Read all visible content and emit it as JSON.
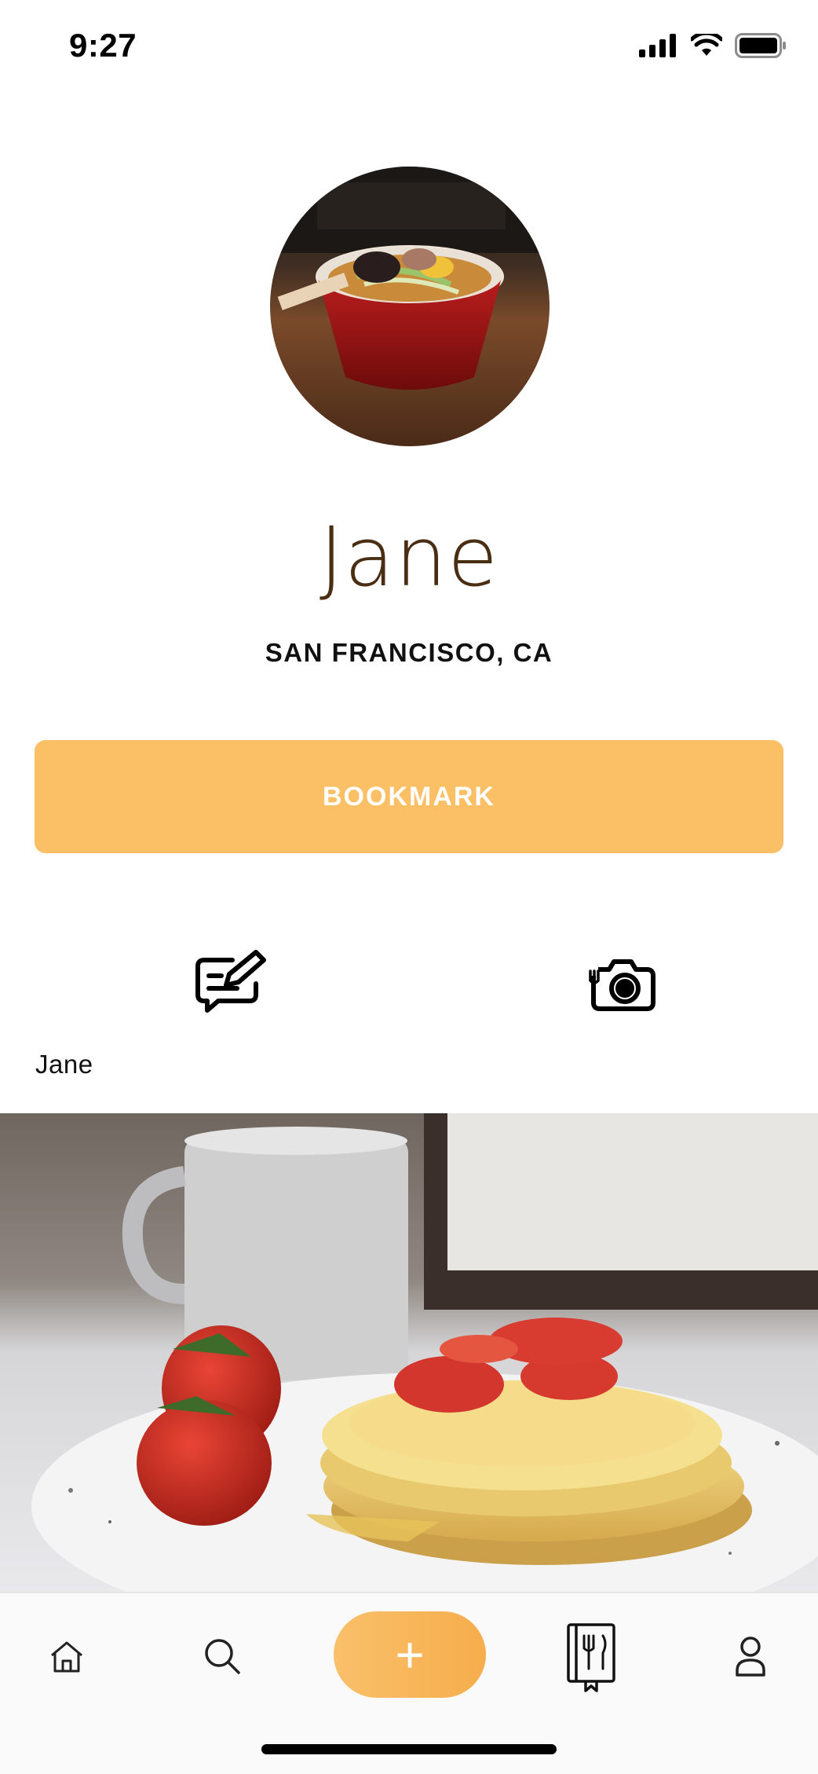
{
  "status_bar": {
    "time": "9:27",
    "icons": [
      "signal-icon",
      "wifi-icon",
      "battery-icon"
    ]
  },
  "profile": {
    "name": "Jane",
    "location": "SAN FRANCISCO, CA",
    "avatar_description_icon": "avatar-ramen-photo"
  },
  "actions": {
    "bookmark_label": "BOOKMARK",
    "edit_icon": "edit-review-icon",
    "camera_icon": "food-camera-icon"
  },
  "post": {
    "author": "Jane",
    "photo_icon": "pancakes-photo"
  },
  "tabbar": {
    "items": [
      "home-icon",
      "search-icon",
      "add-icon",
      "menu-book-icon",
      "profile-icon"
    ],
    "add_label": "+"
  },
  "colors": {
    "accent": "#fbbf66",
    "name_color": "#4a2e14"
  }
}
